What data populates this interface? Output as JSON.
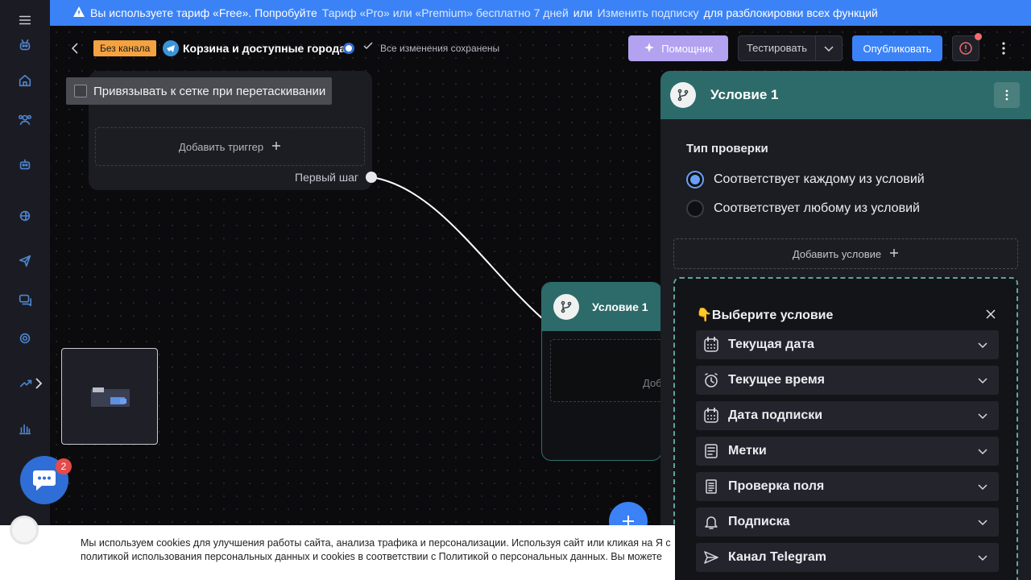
{
  "banner": {
    "text1": "Вы используете тариф «Free». Попробуйте",
    "link1": "Тариф «Pro» или «Premium» бесплатно 7 дней",
    "text2": "или",
    "link2": "Изменить подписку",
    "text3": "для разблокировки всех функций"
  },
  "topbar": {
    "channel_tag": "Без канала",
    "bot_title": "Корзина и доступные города",
    "saved_status": "Все изменения сохранены",
    "helper_label": "Помощник",
    "test_label": "Тестировать",
    "publish_label": "Опубликовать"
  },
  "canvas": {
    "snap_label": "Привязывать к сетке при перетаскивании",
    "add_trigger_label": "Добавить триггер",
    "first_step_label": "Первый шаг",
    "condition_node_title": "Условие 1",
    "condition_node_add": "Доб"
  },
  "chat": {
    "unread_count": "2"
  },
  "panel": {
    "title": "Условие 1",
    "check_type_title": "Тип проверки",
    "radio_all": "Соответствует каждому из условий",
    "radio_any": "Соответствует любому из условий",
    "selected": "all",
    "add_condition_label": "Добавить условие",
    "chooser_title": "👇Выберите условие",
    "options": [
      {
        "label": "Текущая дата",
        "icon": "calendar-icon"
      },
      {
        "label": "Текущее время",
        "icon": "clock-icon"
      },
      {
        "label": "Дата подписки",
        "icon": "calendar-icon"
      },
      {
        "label": "Метки",
        "icon": "tags-icon"
      },
      {
        "label": "Проверка поля",
        "icon": "document-icon"
      },
      {
        "label": "Подписка",
        "icon": "bell-icon"
      },
      {
        "label": "Канал Telegram",
        "icon": "send-icon"
      }
    ]
  },
  "cookie": {
    "line1": "Мы используем cookies для улучшения работы сайта, анализа трафика и персонализации. Используя сайт или кликая на Я с",
    "line2": "политикой использования персональных данных и cookies в соответствии с Политикой о персональных данных. Вы можете"
  },
  "colors": {
    "accent": "#3b82f6",
    "node_head": "#2d6b6a",
    "tag": "#f4a340"
  }
}
